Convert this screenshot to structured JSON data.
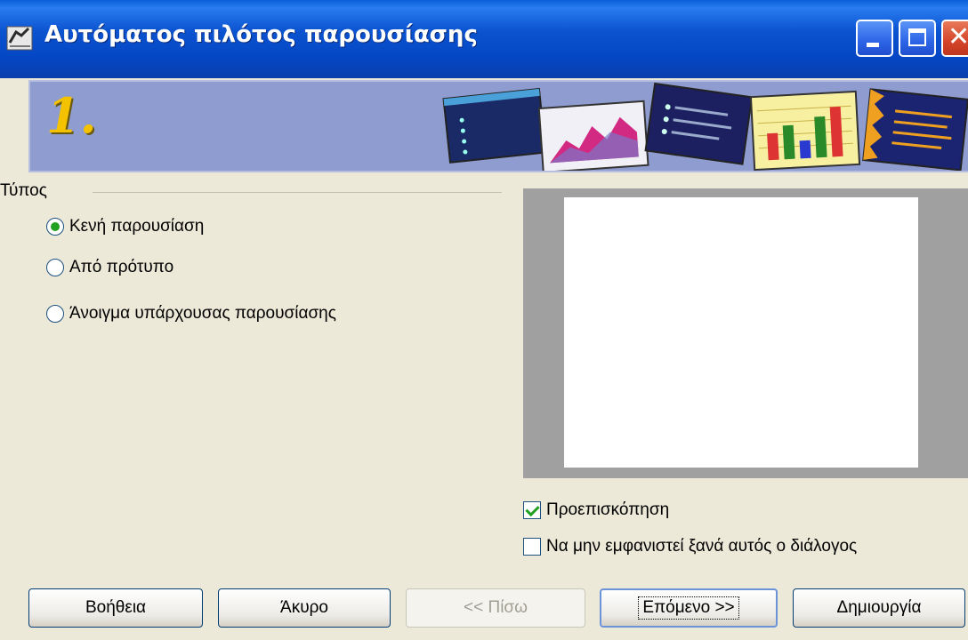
{
  "window": {
    "title": "Αυτόματος πιλότος παρουσίασης"
  },
  "banner": {
    "step": "1."
  },
  "type_section": {
    "legend": "Τύπος",
    "options": [
      {
        "label": "Κενή παρουσίαση",
        "checked": true
      },
      {
        "label": "Από πρότυπο",
        "checked": false
      },
      {
        "label": "Άνοιγμα υπάρχουσας παρουσίασης",
        "checked": false
      }
    ]
  },
  "preview_checkbox": {
    "label": "Προεπισκόπηση",
    "checked": true
  },
  "no_show_checkbox": {
    "label": "Να μην εμφανιστεί ξανά αυτός ο διάλογος",
    "checked": false
  },
  "buttons": {
    "help": "Βοήθεια",
    "cancel": "Άκυρο",
    "back": "<< Πίσω",
    "next": "Επόμενο >>",
    "create": "Δημιουργία"
  },
  "colors": {
    "titlebar": "#0b53d0",
    "banner": "#8f9ccf",
    "radio_dot": "#21a121"
  }
}
